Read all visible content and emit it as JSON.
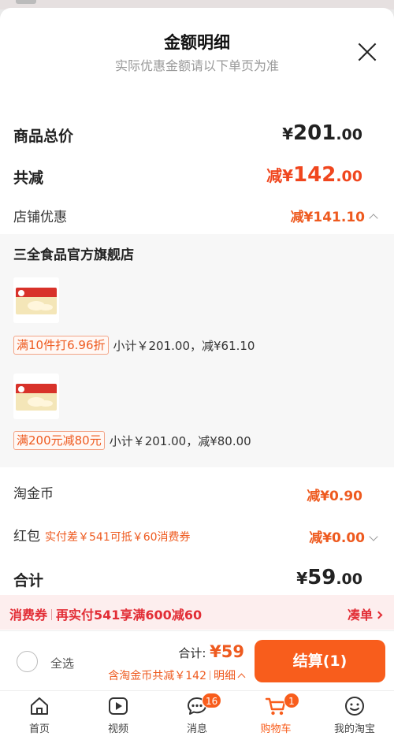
{
  "sheet": {
    "title": "金额明细",
    "subtitle": "实际优惠金额请以下单页为准"
  },
  "summary": {
    "goods_total_label": "商品总价",
    "goods_total": {
      "cur": "¥",
      "int": "201",
      "dec": ".00"
    },
    "total_discount_label": "共减",
    "total_discount": {
      "prefix": "减",
      "cur": "¥",
      "int": "142",
      "dec": ".00"
    },
    "store_discount_label": "店铺优惠",
    "store_discount": "减¥141.10"
  },
  "store": {
    "name": "三全食品官方旗舰店",
    "promos": [
      {
        "tag": "满10件打6.96折",
        "subtotal": "小计￥201.00，减¥61.10"
      },
      {
        "tag": "满200元减80元",
        "subtotal": "小计￥201.00，减¥80.00"
      }
    ]
  },
  "extras": {
    "coin_label": "淘金币",
    "coin_value": "减¥0.90",
    "redpacket_label": "红包",
    "redpacket_note": "实付差￥541可抵￥60消费券",
    "redpacket_value": "减¥0.00",
    "sum_label": "合计",
    "sum": {
      "cur": "¥",
      "int": "59",
      "dec": ".00"
    }
  },
  "coupon_bar": {
    "tag": "消费券",
    "text": "再实付541享满600减60",
    "action": "凑单"
  },
  "checkout": {
    "select_all": "全选",
    "total_label": "合计: ",
    "total_value": "¥59",
    "detail_text": "含淘金币共减￥142",
    "detail_link": "明细",
    "pay_button": "结算(1)"
  },
  "tabbar": {
    "tabs": [
      {
        "label": "首页",
        "icon": "home-icon"
      },
      {
        "label": "视频",
        "icon": "video-icon"
      },
      {
        "label": "消息",
        "icon": "message-icon",
        "badge": "16"
      },
      {
        "label": "购物车",
        "icon": "cart-icon",
        "badge": "1",
        "active": true
      },
      {
        "label": "我的淘宝",
        "icon": "profile-icon"
      }
    ]
  },
  "colors": {
    "accent": "#f85d1c",
    "discount_red": "#f0461e",
    "coupon_red": "#e22d35"
  }
}
